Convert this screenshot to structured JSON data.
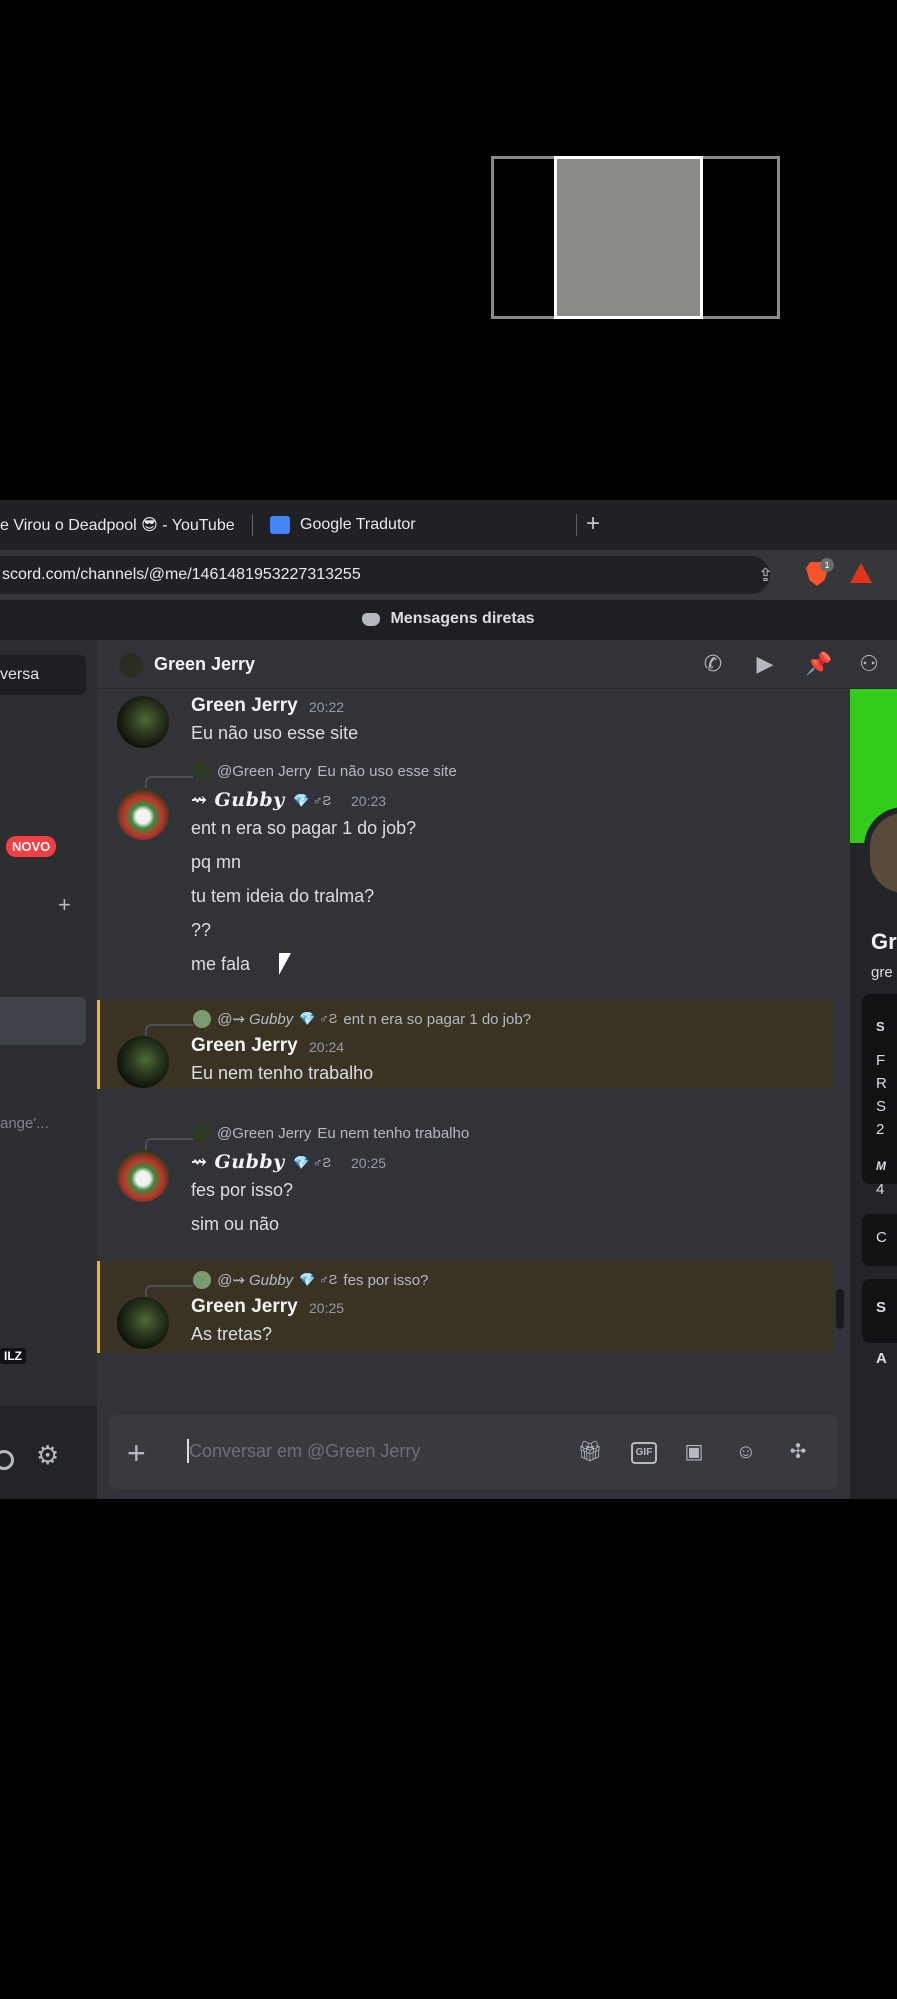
{
  "tabs": [
    {
      "label": "e Virou o Deadpool 😎 - YouTube"
    },
    {
      "label": "Google Tradutor"
    }
  ],
  "address": {
    "url": "scord.com/channels/@me/1461481953227313255",
    "brave_badge": "1"
  },
  "dm_header": {
    "label": "Mensagens diretas"
  },
  "sidebar": {
    "conversation_label": "versa",
    "new_badge": "NOVO",
    "snippet": "ange'...",
    "tag": "ILZ"
  },
  "chat_header": {
    "name": "Green Jerry"
  },
  "messages": [
    {
      "author": "Green Jerry",
      "time": "20:22",
      "lines": [
        "Eu não uso esse site"
      ]
    },
    {
      "reply_to": "@Green Jerry",
      "reply_text": "Eu não uso esse site",
      "author": "⇝ Gubby",
      "time": "20:23",
      "lines": [
        "ent n era so pagar 1 do job?",
        "pq mn",
        "tu tem ideia do tralma?",
        "??",
        "me fala"
      ]
    },
    {
      "reply_to": "@⇝ Gubby",
      "reply_text": "ent n era so pagar 1 do job?",
      "author": "Green Jerry",
      "time": "20:24",
      "lines": [
        "Eu nem tenho trabalho"
      ]
    },
    {
      "reply_to": "@Green Jerry",
      "reply_text": "Eu nem tenho trabalho",
      "author": "⇝ Gubby",
      "time": "20:25",
      "lines": [
        "fes por isso?",
        "sim ou não"
      ]
    },
    {
      "reply_to": "@⇝ Gubby",
      "reply_text": "fes por isso?",
      "author": "Green Jerry",
      "time": "20:25",
      "lines": [
        "As tretas?"
      ]
    }
  ],
  "gubby_badges": "💎 ♂Ƨ",
  "input": {
    "placeholder": "Conversar em @Green Jerry"
  },
  "profile": {
    "name": "Gr",
    "username": "gre",
    "section_initials": [
      "S",
      "F",
      "R",
      "S",
      "2",
      "M",
      "4",
      "C",
      "S",
      "A"
    ]
  },
  "colors": {
    "accent_banner": "#33cc1b",
    "mention_highlight": "#f0b232",
    "new_badge": "#f23f42"
  }
}
